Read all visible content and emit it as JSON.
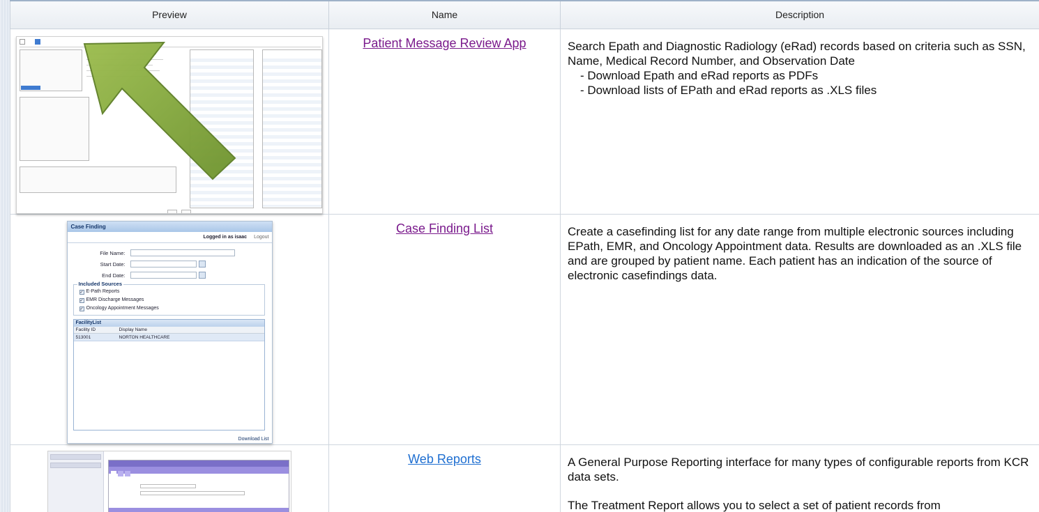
{
  "table": {
    "headers": {
      "preview": "Preview",
      "name": "Name",
      "description": "Description"
    },
    "rows": [
      {
        "name": "Patient Message Review App",
        "description": "Search Epath and Diagnostic Radiology (eRad) records based on criteria such as SSN, Name, Medical Record Number, and Observation Date",
        "bullets": [
          "Download Epath and eRad reports as PDFs",
          "Download lists of EPath and eRad reports as .XLS files"
        ]
      },
      {
        "name": "Case Finding List",
        "description": "Create a casefinding list for any date range from multiple electronic sources including EPath, EMR, and Oncology Appointment data. Results are downloaded as an .XLS file and are grouped by patient name. Each patient has an indication of the source of electronic casefindings data."
      },
      {
        "name": "Web Reports",
        "description": "A General Purpose Reporting interface for many types of configurable reports from KCR data sets.",
        "description_2": "The Treatment Report allows you to select a set of patient records from"
      }
    ]
  },
  "colors": {
    "visited_link": "#7a1a8c",
    "link": "#1f6fd1",
    "arrow": "#7ea23a"
  },
  "thumb_case_finding": {
    "title": "Case Finding",
    "logged_in": "Logged in as isaac",
    "logout": "Logout",
    "file_name_label": "File Name:",
    "start_date_label": "Start Date:",
    "end_date_label": "End Date:",
    "sources_legend": "Included Sources",
    "sources": [
      "E-Path Reports",
      "EMR Discharge Messages",
      "Oncology Appointment Messages"
    ],
    "grid_title": "FacilityList",
    "grid_headers": [
      "Facility ID",
      "Display Name"
    ],
    "grid_row": [
      "513001",
      "NORTON HEALTHCARE"
    ],
    "download": "Download List"
  }
}
